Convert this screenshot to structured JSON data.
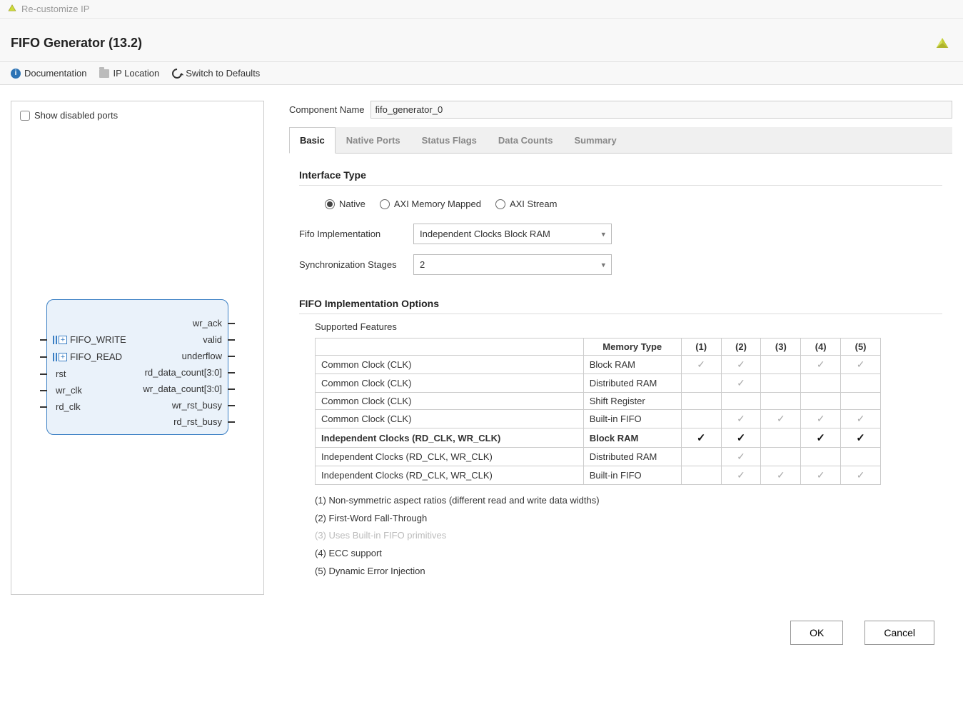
{
  "window_title": "Re-customize IP",
  "header_title": "FIFO Generator (13.2)",
  "toolbar": {
    "documentation": "Documentation",
    "ip_location": "IP Location",
    "switch_defaults": "Switch to Defaults"
  },
  "left_panel": {
    "show_disabled_ports": "Show disabled ports",
    "ports_left": [
      "FIFO_WRITE",
      "FIFO_READ",
      "rst",
      "wr_clk",
      "rd_clk"
    ],
    "ports_right": [
      "wr_ack",
      "valid",
      "underflow",
      "rd_data_count[3:0]",
      "wr_data_count[3:0]",
      "wr_rst_busy",
      "rd_rst_busy"
    ]
  },
  "component_name_label": "Component Name",
  "component_name_value": "fifo_generator_0",
  "tabs": [
    "Basic",
    "Native Ports",
    "Status Flags",
    "Data Counts",
    "Summary"
  ],
  "active_tab": 0,
  "basic": {
    "interface_type_heading": "Interface Type",
    "interface_options": [
      "Native",
      "AXI Memory Mapped",
      "AXI Stream"
    ],
    "interface_selected": 0,
    "fifo_impl_label": "Fifo Implementation",
    "fifo_impl_value": "Independent Clocks Block RAM",
    "sync_stages_label": "Synchronization Stages",
    "sync_stages_value": "2",
    "fifo_options_heading": "FIFO Implementation Options",
    "supported_features_label": "Supported Features",
    "table_headers": [
      "",
      "Memory Type",
      "(1)",
      "(2)",
      "(3)",
      "(4)",
      "(5)"
    ],
    "table_rows": [
      {
        "cfg": "Common Clock (CLK)",
        "mem": "Block RAM",
        "c": [
          "l",
          "l",
          "",
          "l",
          "l"
        ],
        "bold": false
      },
      {
        "cfg": "Common Clock (CLK)",
        "mem": "Distributed RAM",
        "c": [
          "",
          "l",
          "",
          "",
          ""
        ],
        "bold": false
      },
      {
        "cfg": "Common Clock (CLK)",
        "mem": "Shift Register",
        "c": [
          "",
          "",
          "",
          "",
          ""
        ],
        "bold": false
      },
      {
        "cfg": "Common Clock (CLK)",
        "mem": "Built-in FIFO",
        "c": [
          "",
          "l",
          "l",
          "l",
          "l"
        ],
        "bold": false
      },
      {
        "cfg": "Independent Clocks (RD_CLK, WR_CLK)",
        "mem": "Block RAM",
        "c": [
          "b",
          "b",
          "",
          "b",
          "b"
        ],
        "bold": true
      },
      {
        "cfg": "Independent Clocks (RD_CLK, WR_CLK)",
        "mem": "Distributed RAM",
        "c": [
          "",
          "l",
          "",
          "",
          ""
        ],
        "bold": false
      },
      {
        "cfg": "Independent Clocks (RD_CLK, WR_CLK)",
        "mem": "Built-in FIFO",
        "c": [
          "",
          "l",
          "l",
          "l",
          "l"
        ],
        "bold": false
      }
    ],
    "legend": [
      "(1) Non-symmetric aspect ratios (different read and write data widths)",
      "(2) First-Word Fall-Through",
      "(3) Uses Built-in FIFO primitives",
      "(4) ECC support",
      "(5) Dynamic Error Injection"
    ],
    "legend_disabled_index": 2
  },
  "buttons": {
    "ok": "OK",
    "cancel": "Cancel"
  }
}
